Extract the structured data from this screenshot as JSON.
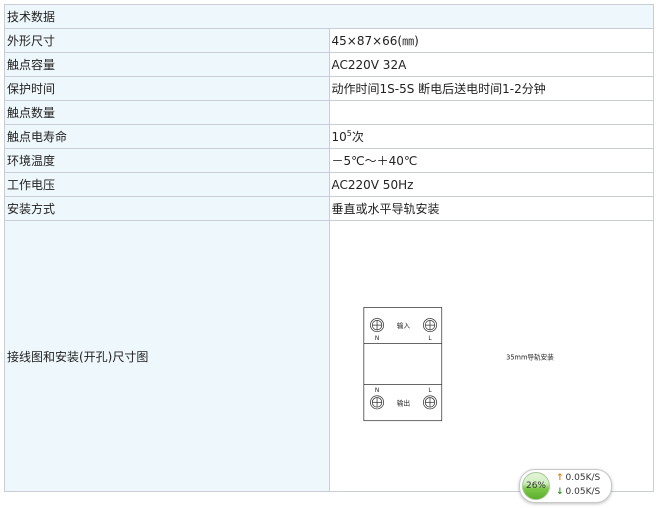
{
  "title": "技术数据",
  "rows": [
    {
      "label": "外形尺寸",
      "value": "45×87×66(㎜)"
    },
    {
      "label": "触点容量",
      "value": "AC220V 32A"
    },
    {
      "label": "保护时间",
      "value": "动作时间1S-5S 断电后送电时间1-2分钟"
    },
    {
      "label": "触点数量",
      "value": ""
    },
    {
      "label": "触点电寿命",
      "value_base": "10",
      "value_sup": "5",
      "value_tail": "次"
    },
    {
      "label": "环境温度",
      "value": "－5℃～＋40℃"
    },
    {
      "label": "工作电压",
      "value": "AC220V 50Hz"
    },
    {
      "label": "安装方式",
      "value": "垂直或水平导轨安装"
    }
  ],
  "diagram": {
    "label": "接线图和安装(开孔)尺寸图",
    "input_label": "输入",
    "output_label": "输出",
    "n_label": "N",
    "l_label": "L",
    "rail_text": "35mm导轨安装"
  },
  "widget": {
    "percent": "26%",
    "up_arrow": "↑",
    "down_arrow": "↓",
    "upload": "0.05K/S",
    "download": "0.05K/S"
  }
}
